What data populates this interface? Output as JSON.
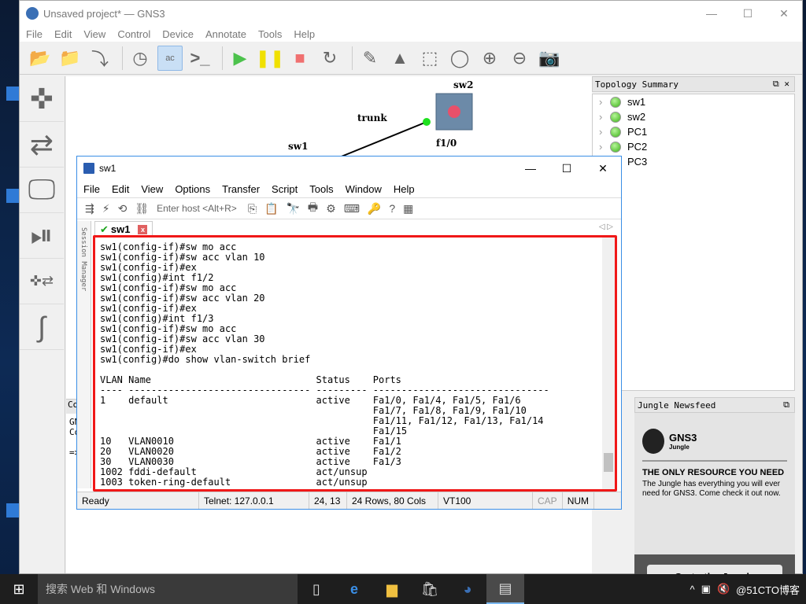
{
  "gns3": {
    "title": "Unsaved project* — GNS3",
    "menu": [
      "File",
      "Edit",
      "View",
      "Control",
      "Device",
      "Annotate",
      "Tools",
      "Help"
    ],
    "toolbar": [
      "new-project",
      "open-project",
      "save-project",
      "snapshot",
      "show-interface-labels",
      "console-all",
      "start-all",
      "suspend-all",
      "stop-all",
      "reload-all",
      "add-note",
      "insert-image",
      "draw-rectangle",
      "draw-ellipse",
      "zoom-in",
      "zoom-out",
      "screenshot"
    ],
    "devices": [
      "routers",
      "switches",
      "end-devices",
      "security-devices",
      "all-devices",
      "add-link"
    ],
    "canvas": {
      "nodes": [
        {
          "name": "sw2"
        },
        {
          "name": "sw1"
        }
      ],
      "link_label": "trunk",
      "port_label": "f1/0"
    },
    "topology": {
      "title": "Topology Summary",
      "items": [
        "sw1",
        "sw2",
        "PC1",
        "PC2",
        "PC3"
      ]
    },
    "console": {
      "title": "Co",
      "lines": [
        "GN",
        "Co",
        "",
        "=>"
      ]
    },
    "news": {
      "title": "Jungle Newsfeed",
      "brand": "GNS3",
      "sub": "Jungle",
      "headline": "THE ONLY RESOURCE YOU NEED",
      "body": "The Jungle has everything you will ever need for GNS3. Come check it out now.",
      "button": "Go to the Jungle"
    }
  },
  "crt": {
    "title": "sw1",
    "menu": [
      "File",
      "Edit",
      "View",
      "Options",
      "Transfer",
      "Script",
      "Tools",
      "Window",
      "Help"
    ],
    "host_placeholder": "Enter host <Alt+R>",
    "tab": "sw1",
    "session_manager": "Session Manager",
    "terminal": "sw1(config-if)#sw mo acc\nsw1(config-if)#sw acc vlan 10\nsw1(config-if)#ex\nsw1(config)#int f1/2\nsw1(config-if)#sw mo acc\nsw1(config-if)#sw acc vlan 20\nsw1(config-if)#ex\nsw1(config)#int f1/3\nsw1(config-if)#sw mo acc\nsw1(config-if)#sw acc vlan 30\nsw1(config-if)#ex\nsw1(config)#do show vlan-switch brief\n\nVLAN Name                             Status    Ports\n---- -------------------------------- --------- -------------------------------\n1    default                          active    Fa1/0, Fa1/4, Fa1/5, Fa1/6\n                                                Fa1/7, Fa1/8, Fa1/9, Fa1/10\n                                                Fa1/11, Fa1/12, Fa1/13, Fa1/14\n                                                Fa1/15\n10   VLAN0010                         active    Fa1/1\n20   VLAN0020                         active    Fa1/2\n30   VLAN0030                         active    Fa1/3\n1002 fddi-default                     act/unsup\n1003 token-ring-default               act/unsup",
    "status": {
      "ready": "Ready",
      "conn": "Telnet: 127.0.0.1",
      "pos": "24,  13",
      "size": "24 Rows, 80 Cols",
      "term": "VT100",
      "cap": "CAP",
      "num": "NUM"
    }
  },
  "taskbar": {
    "search": "搜索 Web 和 Windows",
    "tray_text": "@51CTO博客"
  }
}
